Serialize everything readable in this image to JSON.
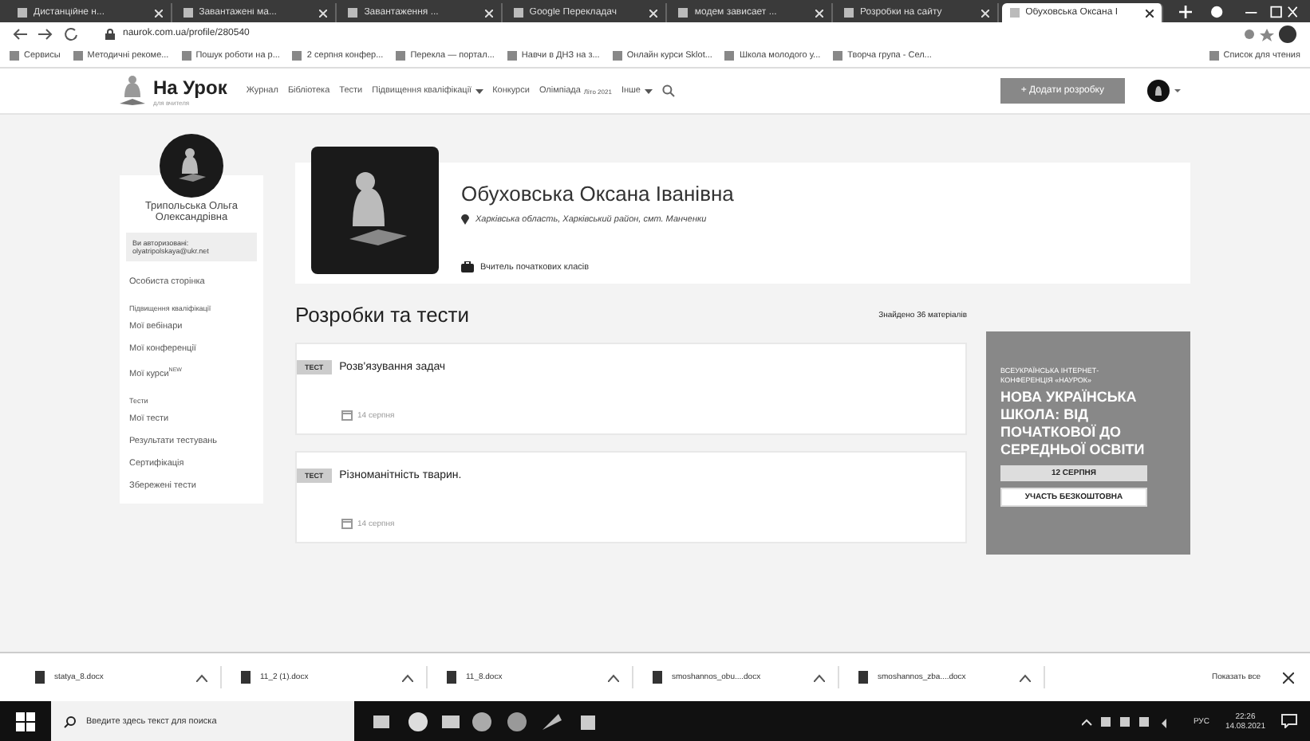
{
  "browser": {
    "tabs": [
      {
        "title": "Дистанційне н...",
        "selected": false
      },
      {
        "title": "Завантажені ма...",
        "selected": false
      },
      {
        "title": "Завантаження ...",
        "selected": false
      },
      {
        "title": "Google Перекладач",
        "selected": false
      },
      {
        "title": "модем зависает ...",
        "selected": false
      },
      {
        "title": "Розробки на сайту",
        "selected": false
      },
      {
        "title": "Обуховська Оксана І",
        "selected": true
      }
    ],
    "address": "naurok.com.ua/profile/280540",
    "bookmarks": [
      "Сервисы",
      "Методичні рекоме...",
      "Пошук роботи на р...",
      "2 серпня конфер...",
      "Перекла — портал...",
      "Навчи в ДНЗ на з...",
      "Онлайн курси Sklot...",
      "Школа молодого у...",
      "Творча група - Сел..."
    ],
    "reading_list": "Список для чтения"
  },
  "site": {
    "logo": "На Урок",
    "logo_sub": "для вчителя",
    "nav": [
      {
        "label": "Журнал",
        "dropdown": false
      },
      {
        "label": "Бібліотека",
        "dropdown": false
      },
      {
        "label": "Тести",
        "dropdown": false
      },
      {
        "label": "Підвищення кваліфікації",
        "dropdown": true
      },
      {
        "label": "Конкурси",
        "dropdown": false
      },
      {
        "label": "Олімпіада",
        "dropdown": false,
        "badge": "Літо 2021"
      },
      {
        "label": "Інше",
        "dropdown": true
      }
    ],
    "add_button": "+ Додати розробку"
  },
  "sidebar": {
    "user_name": "Трипольська Ольга Олександрівна",
    "login_label": "Ви авторизовані:",
    "login_email": "olyatripolskaya@ukr.net",
    "items": [
      {
        "label": "Особиста сторінка",
        "kind": "link"
      },
      {
        "label": "Підвищення кваліфікації",
        "kind": "heading"
      },
      {
        "label": "Мої вебінари",
        "kind": "link"
      },
      {
        "label": "Мої конференції",
        "kind": "link"
      },
      {
        "label": "Мої курси",
        "kind": "link",
        "badge": "NEW"
      },
      {
        "label": "Тести",
        "kind": "heading"
      },
      {
        "label": "Мої тести",
        "kind": "link"
      },
      {
        "label": "Результати тестувань",
        "kind": "link"
      },
      {
        "label": "Сертифікація",
        "kind": "link"
      },
      {
        "label": "Збережені тести",
        "kind": "link"
      }
    ]
  },
  "profile": {
    "name": "Обуховська Оксана Іванівна",
    "location": "Харківська область, Харківський район, смт. Манченки",
    "position": "Вчитель початкових класів"
  },
  "materials": {
    "title": "Розробки та тести",
    "found": "Знайдено 36 матеріалів",
    "items": [
      {
        "tag": "ТЕСТ",
        "title": "Розв'язування задач",
        "date": "14 серпня"
      },
      {
        "tag": "ТЕСТ",
        "title": "Різноманітність тварин.",
        "date": "14 серпня"
      }
    ]
  },
  "banner": {
    "kicker": "ВСЕУКРАЇНСЬКА ІНТЕРНЕТ-КОНФЕРЕНЦІЯ «НАУРОК»",
    "headline": "НОВА УКРАЇНСЬКА ШКОЛА: ВІД ПОЧАТКОВОЇ ДО СЕРЕДНЬОЇ ОСВІТИ",
    "date": "12 СЕРПНЯ",
    "cta": "УЧАСТЬ БЕЗКОШТОВНА"
  },
  "downloads": {
    "files": [
      "statya_8.docx",
      "11_2 (1).docx",
      "11_8.docx",
      "smoshannos_obu....docx",
      "smoshannos_zba....docx"
    ],
    "show_all": "Показать все"
  },
  "taskbar": {
    "search_placeholder": "Введите здесь текст для поиска",
    "language": "РУС",
    "time": "22:26",
    "date": "14.08.2021"
  }
}
